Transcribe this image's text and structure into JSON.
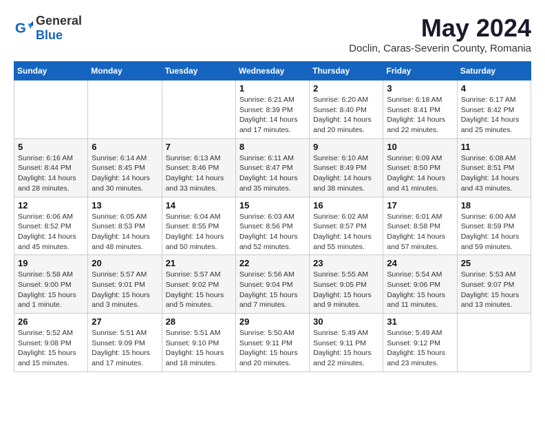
{
  "logo": {
    "general": "General",
    "blue": "Blue"
  },
  "title": "May 2024",
  "subtitle": "Doclin, Caras-Severin County, Romania",
  "weekdays": [
    "Sunday",
    "Monday",
    "Tuesday",
    "Wednesday",
    "Thursday",
    "Friday",
    "Saturday"
  ],
  "weeks": [
    [
      {
        "day": "",
        "info": ""
      },
      {
        "day": "",
        "info": ""
      },
      {
        "day": "",
        "info": ""
      },
      {
        "day": "1",
        "info": "Sunrise: 6:21 AM\nSunset: 8:39 PM\nDaylight: 14 hours\nand 17 minutes."
      },
      {
        "day": "2",
        "info": "Sunrise: 6:20 AM\nSunset: 8:40 PM\nDaylight: 14 hours\nand 20 minutes."
      },
      {
        "day": "3",
        "info": "Sunrise: 6:18 AM\nSunset: 8:41 PM\nDaylight: 14 hours\nand 22 minutes."
      },
      {
        "day": "4",
        "info": "Sunrise: 6:17 AM\nSunset: 8:42 PM\nDaylight: 14 hours\nand 25 minutes."
      }
    ],
    [
      {
        "day": "5",
        "info": "Sunrise: 6:16 AM\nSunset: 8:44 PM\nDaylight: 14 hours\nand 28 minutes."
      },
      {
        "day": "6",
        "info": "Sunrise: 6:14 AM\nSunset: 8:45 PM\nDaylight: 14 hours\nand 30 minutes."
      },
      {
        "day": "7",
        "info": "Sunrise: 6:13 AM\nSunset: 8:46 PM\nDaylight: 14 hours\nand 33 minutes."
      },
      {
        "day": "8",
        "info": "Sunrise: 6:11 AM\nSunset: 8:47 PM\nDaylight: 14 hours\nand 35 minutes."
      },
      {
        "day": "9",
        "info": "Sunrise: 6:10 AM\nSunset: 8:49 PM\nDaylight: 14 hours\nand 38 minutes."
      },
      {
        "day": "10",
        "info": "Sunrise: 6:09 AM\nSunset: 8:50 PM\nDaylight: 14 hours\nand 41 minutes."
      },
      {
        "day": "11",
        "info": "Sunrise: 6:08 AM\nSunset: 8:51 PM\nDaylight: 14 hours\nand 43 minutes."
      }
    ],
    [
      {
        "day": "12",
        "info": "Sunrise: 6:06 AM\nSunset: 8:52 PM\nDaylight: 14 hours\nand 45 minutes."
      },
      {
        "day": "13",
        "info": "Sunrise: 6:05 AM\nSunset: 8:53 PM\nDaylight: 14 hours\nand 48 minutes."
      },
      {
        "day": "14",
        "info": "Sunrise: 6:04 AM\nSunset: 8:55 PM\nDaylight: 14 hours\nand 50 minutes."
      },
      {
        "day": "15",
        "info": "Sunrise: 6:03 AM\nSunset: 8:56 PM\nDaylight: 14 hours\nand 52 minutes."
      },
      {
        "day": "16",
        "info": "Sunrise: 6:02 AM\nSunset: 8:57 PM\nDaylight: 14 hours\nand 55 minutes."
      },
      {
        "day": "17",
        "info": "Sunrise: 6:01 AM\nSunset: 8:58 PM\nDaylight: 14 hours\nand 57 minutes."
      },
      {
        "day": "18",
        "info": "Sunrise: 6:00 AM\nSunset: 8:59 PM\nDaylight: 14 hours\nand 59 minutes."
      }
    ],
    [
      {
        "day": "19",
        "info": "Sunrise: 5:58 AM\nSunset: 9:00 PM\nDaylight: 15 hours\nand 1 minute."
      },
      {
        "day": "20",
        "info": "Sunrise: 5:57 AM\nSunset: 9:01 PM\nDaylight: 15 hours\nand 3 minutes."
      },
      {
        "day": "21",
        "info": "Sunrise: 5:57 AM\nSunset: 9:02 PM\nDaylight: 15 hours\nand 5 minutes."
      },
      {
        "day": "22",
        "info": "Sunrise: 5:56 AM\nSunset: 9:04 PM\nDaylight: 15 hours\nand 7 minutes."
      },
      {
        "day": "23",
        "info": "Sunrise: 5:55 AM\nSunset: 9:05 PM\nDaylight: 15 hours\nand 9 minutes."
      },
      {
        "day": "24",
        "info": "Sunrise: 5:54 AM\nSunset: 9:06 PM\nDaylight: 15 hours\nand 11 minutes."
      },
      {
        "day": "25",
        "info": "Sunrise: 5:53 AM\nSunset: 9:07 PM\nDaylight: 15 hours\nand 13 minutes."
      }
    ],
    [
      {
        "day": "26",
        "info": "Sunrise: 5:52 AM\nSunset: 9:08 PM\nDaylight: 15 hours\nand 15 minutes."
      },
      {
        "day": "27",
        "info": "Sunrise: 5:51 AM\nSunset: 9:09 PM\nDaylight: 15 hours\nand 17 minutes."
      },
      {
        "day": "28",
        "info": "Sunrise: 5:51 AM\nSunset: 9:10 PM\nDaylight: 15 hours\nand 18 minutes."
      },
      {
        "day": "29",
        "info": "Sunrise: 5:50 AM\nSunset: 9:11 PM\nDaylight: 15 hours\nand 20 minutes."
      },
      {
        "day": "30",
        "info": "Sunrise: 5:49 AM\nSunset: 9:11 PM\nDaylight: 15 hours\nand 22 minutes."
      },
      {
        "day": "31",
        "info": "Sunrise: 5:49 AM\nSunset: 9:12 PM\nDaylight: 15 hours\nand 23 minutes."
      },
      {
        "day": "",
        "info": ""
      }
    ]
  ]
}
